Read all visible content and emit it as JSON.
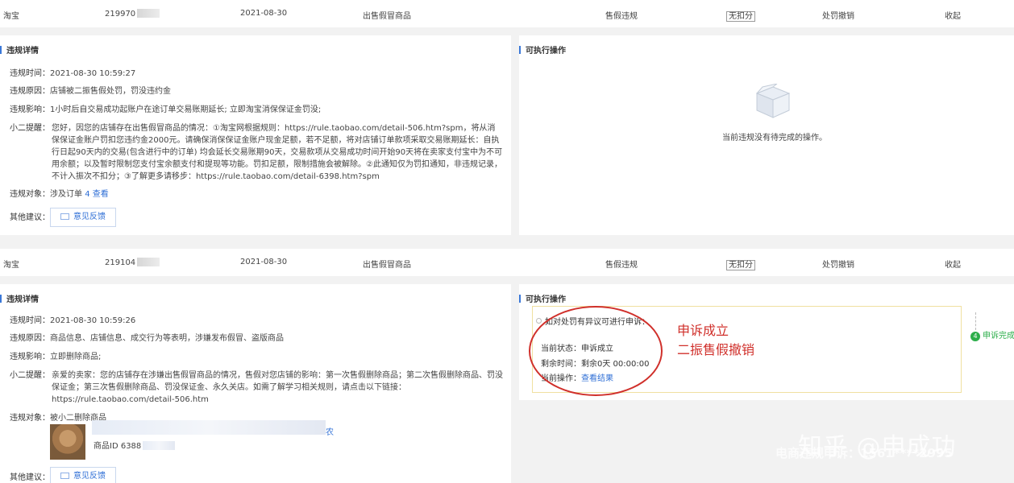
{
  "records": [
    {
      "summary": {
        "platform": "淘宝",
        "id_prefix": "219970",
        "date": "2021-08-30",
        "behavior": "出售假冒商品",
        "type": "售假违规",
        "score": "无扣分",
        "penalty": "处罚撤销",
        "collapse": "收起"
      },
      "detail": {
        "title": "违规详情",
        "time_label": "违规时间：",
        "time": "2021-08-30 10:59:27",
        "reason_label": "违规原因：",
        "reason": "店铺被二振售假处罚，罚没违约金",
        "impact_label": "违规影响：",
        "impact": "1小时后自交易成功起账户在途订单交易账期延长; 立即淘宝消保保证金罚没;",
        "tip_label": "小二提醒：",
        "tip": "您好，因您的店铺存在出售假冒商品的情况：①淘宝网根据规则：https://rule.taobao.com/detail-506.htm?spm，将从消保保证金账户罚扣您违约金2000元。请确保消保保证金账户现金足额，若不足额，将对店铺订单款项采取交易账期延长：自执行日起90天内的交易(包含进行中的订单) 均会延长交易账期90天，交易款项从交易成功时间开始90天将在卖家支付宝中为不可用余额；以及暂时限制您支付宝余额支付和提现等功能。罚扣足额，限制措施会被解除。②此通知仅为罚扣通知，非违规记录，不计入振次不扣分；③了解更多请移步：https://rule.taobao.com/detail-6398.htm?spm",
        "object_label": "违规对象：",
        "object": "涉及订单",
        "object_count": "4",
        "object_link": "查看",
        "other_label": "其他建议：",
        "feedback": "意见反馈"
      },
      "actions": {
        "title": "可执行操作",
        "empty_text": "当前违规没有待完成的操作。"
      }
    },
    {
      "summary": {
        "platform": "淘宝",
        "id_prefix": "219104",
        "date": "2021-08-30",
        "behavior": "出售假冒商品",
        "type": "售假违规",
        "score": "无扣分",
        "penalty": "处罚撤销",
        "collapse": "收起"
      },
      "detail": {
        "title": "违规详情",
        "time_label": "违规时间：",
        "time": "2021-08-30 10:59:26",
        "reason_label": "违规原因：",
        "reason": "商品信息、店铺信息、成交行为等表明，涉嫌发布假冒、盗版商品",
        "impact_label": "违规影响：",
        "impact": "立即删除商品;",
        "tip_label": "小二提醒：",
        "tip": "亲爱的卖家：您的店铺存在涉嫌出售假冒商品的情况，售假对您店铺的影响：第一次售假删除商品；第二次售假删除商品、罚没保证金；第三次售假删除商品、罚没保证金、永久关店。如需了解学习相关规则，请点击以下链接：https://rule.taobao.com/detail-506.htm",
        "object_label": "违规对象：",
        "object": "被小二删除商品",
        "product_id_label": "商品ID 6388",
        "product_tail": "农",
        "other_label": "其他建议：",
        "feedback": "意见反馈"
      },
      "actions": {
        "title": "可执行操作",
        "appeal_title": "如对处罚有异议可进行申诉：",
        "status_label": "当前状态：",
        "status": "申诉成立",
        "remaining_label": "剩余时间：",
        "remaining": "剩余0天 00:00:00",
        "op_label": "当前操作：",
        "op_link": "查看结果",
        "step_num": "4",
        "step_label": "申诉完成"
      },
      "annotation": {
        "line1": "申诉成立",
        "line2": "二振售假撤销"
      }
    }
  ],
  "watermark": {
    "text": "知乎 @申成功",
    "sub": "电商违规申诉：1561****2995"
  },
  "icons": [
    "mail-icon",
    "empty-box-icon",
    "step-check-icon"
  ]
}
